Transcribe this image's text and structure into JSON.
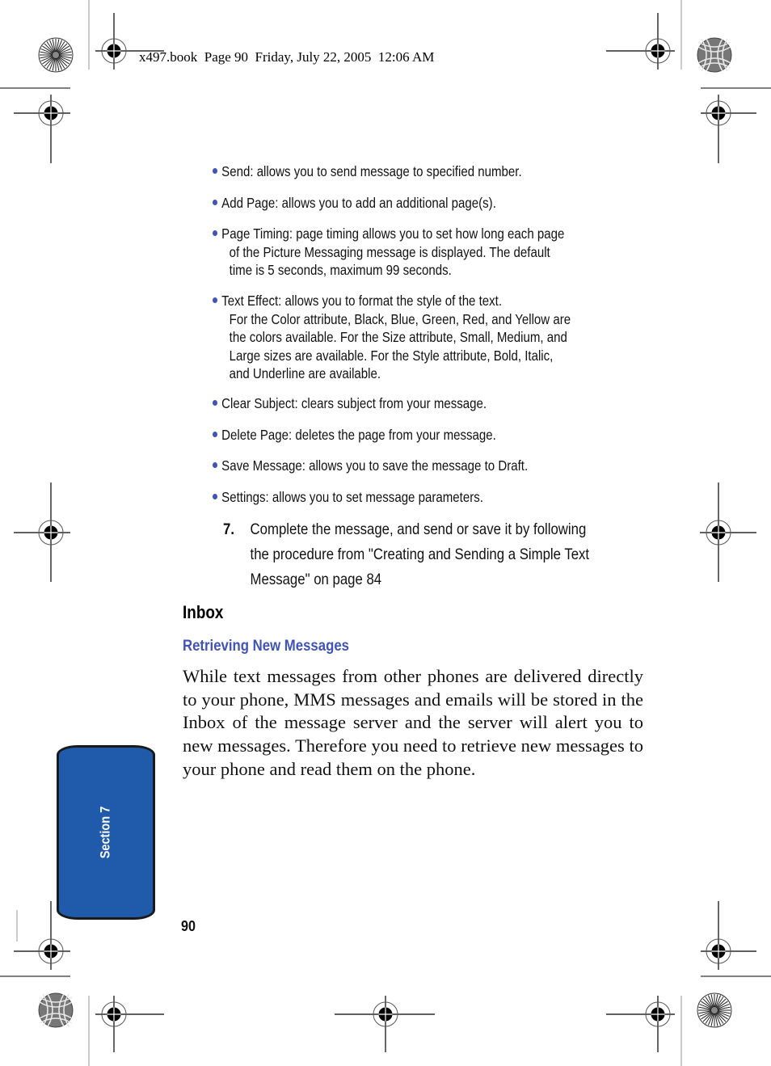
{
  "slug": {
    "text": "x497.book  Page 90  Friday, July 22, 2005  12:06 AM"
  },
  "options_list": [
    {
      "first": "Send: allows you to send message to specified number.",
      "continuation": []
    },
    {
      "first": "Add Page: allows you to add an additional page(s).",
      "continuation": []
    },
    {
      "first": "Page Timing: page timing allows you to set how long each page",
      "continuation": [
        "of the Picture Messaging message is displayed. The default",
        "time is 5 seconds, maximum 99 seconds."
      ]
    },
    {
      "first": "Text Effect: allows you to format the style of the text.",
      "continuation": [
        "For the Color attribute, Black, Blue, Green, Red, and Yellow are",
        "the colors available. For the Size attribute, Small, Medium, and",
        "Large sizes are available. For the Style attribute, Bold, Italic,",
        "and Underline are available."
      ]
    },
    {
      "first": "Clear Subject: clears subject from your message.",
      "continuation": []
    },
    {
      "first": "Delete Page: deletes the page from your message.",
      "continuation": []
    },
    {
      "first": "Save Message: allows you to save the message to Draft.",
      "continuation": []
    },
    {
      "first": "Settings: allows you to set message parameters.",
      "continuation": []
    }
  ],
  "step": {
    "number": "7.",
    "lines": [
      "Complete the message, and send or save it by following",
      "the procedure from \"Creating and Sending a Simple Text",
      "Message\" on page 84"
    ]
  },
  "section_heading": "Inbox",
  "subsection_heading": "Retrieving New Messages",
  "body_paragraph": "While text messages from other phones are delivered directly to your phone, MMS messages and emails will be stored in the Inbox of the message server and the server will alert you to new messages. Therefore you need to retrieve new messages to your phone and read them on the phone.",
  "side_tab": {
    "label": "Section 7"
  },
  "page_number": "90",
  "colors": {
    "accent_blue": "#3f53b8",
    "tab_blue": "#1f5aab",
    "text": "#111111"
  }
}
